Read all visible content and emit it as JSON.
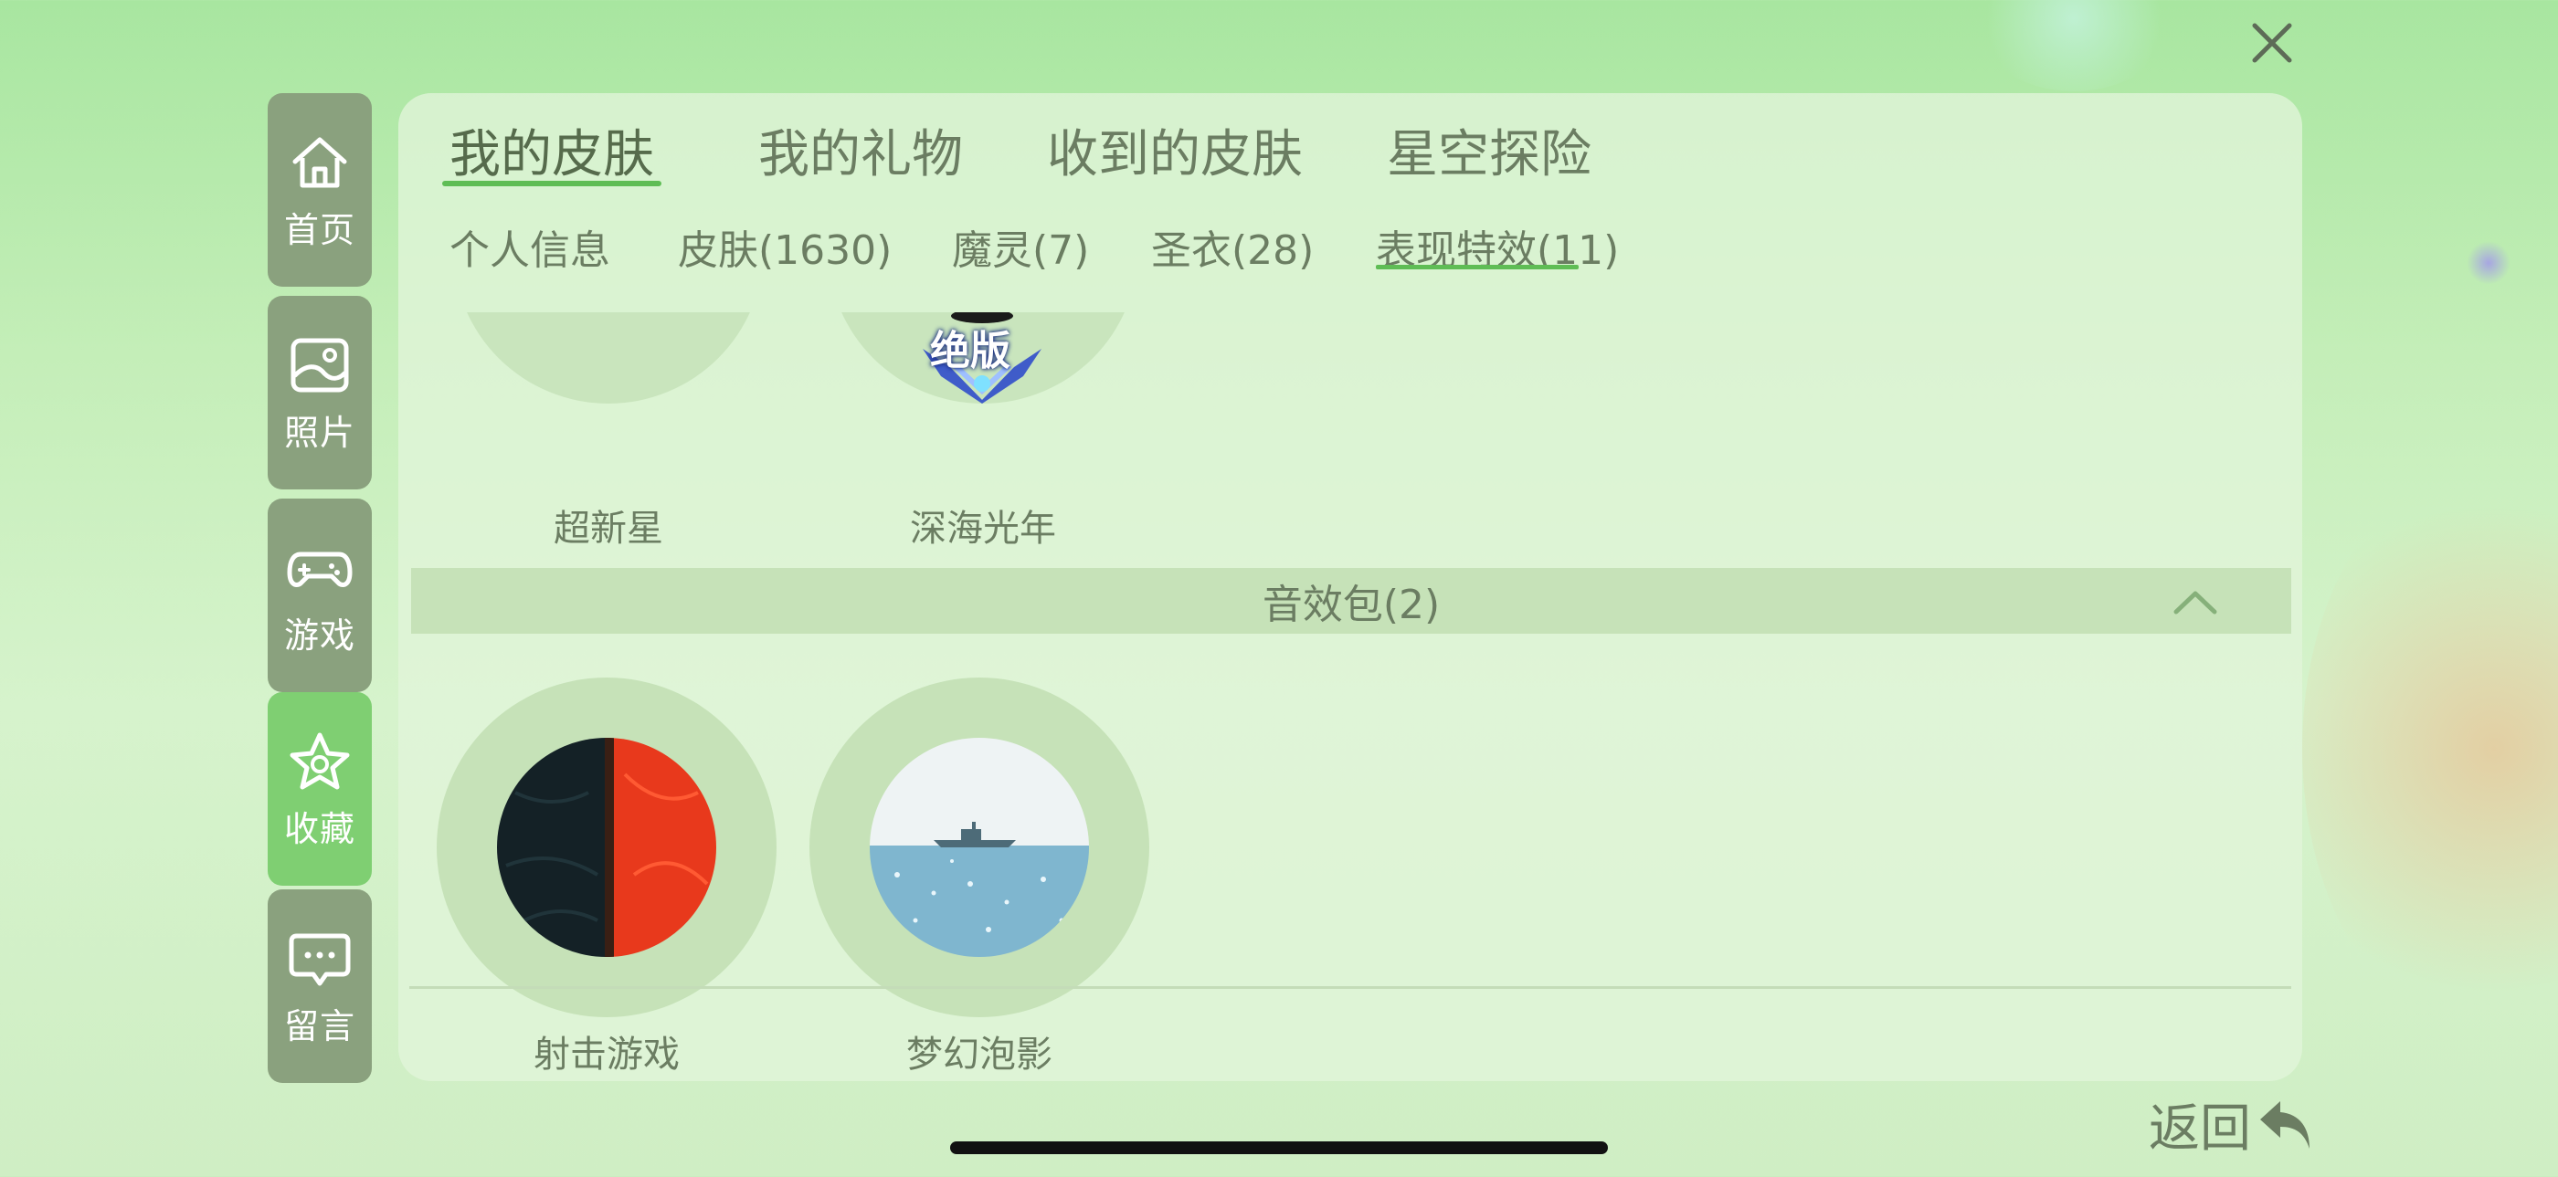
{
  "close_icon": "close-icon",
  "sidebar": {
    "items": [
      {
        "label": "首页",
        "icon": "home-icon"
      },
      {
        "label": "照片",
        "icon": "image-icon"
      },
      {
        "label": "游戏",
        "icon": "gamepad-icon"
      },
      {
        "label": "收藏",
        "icon": "star-icon",
        "active": true
      },
      {
        "label": "留言",
        "icon": "message-icon"
      }
    ]
  },
  "tabs": [
    {
      "label": "我的皮肤",
      "active": true
    },
    {
      "label": "我的礼物"
    },
    {
      "label": "收到的皮肤"
    },
    {
      "label": "星空探险"
    }
  ],
  "subtabs": [
    {
      "label": "个人信息"
    },
    {
      "label": "皮肤(1630)"
    },
    {
      "label": "魔灵(7)"
    },
    {
      "label": "圣衣(28)"
    },
    {
      "label": "表现特效(11)",
      "active": true
    }
  ],
  "effects_items": [
    {
      "label": "超新星"
    },
    {
      "label": "深海光年",
      "badge": "绝版"
    }
  ],
  "sound_section": {
    "title": "音效包(2)",
    "expanded": true,
    "items": [
      {
        "label": "射击游戏"
      },
      {
        "label": "梦幻泡影"
      }
    ]
  },
  "back": {
    "label": "返回"
  },
  "colors": {
    "accent": "#5fbd55",
    "sidebar": "#8aa17e",
    "sidebar_active": "#7fcf72"
  }
}
